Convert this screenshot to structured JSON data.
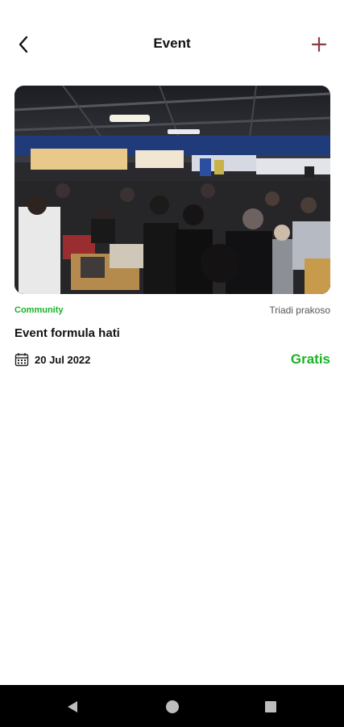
{
  "app_bar": {
    "title": "Event",
    "back_icon": "chevron-left-icon",
    "add_icon": "plus-icon",
    "accent_color": "#8b3a46"
  },
  "event": {
    "category": "Community",
    "organizer": "Triadi prakoso",
    "name": "Event formula hati",
    "date": "20 Jul 2022",
    "price": "Gratis",
    "date_icon": "calendar-icon",
    "image": "crowded-indoor-record-market-photo",
    "category_color": "#19b326",
    "price_color": "#19b326"
  },
  "system_nav": {
    "back_icon": "triangle-back-icon",
    "home_icon": "circle-home-icon",
    "recents_icon": "square-recents-icon"
  }
}
